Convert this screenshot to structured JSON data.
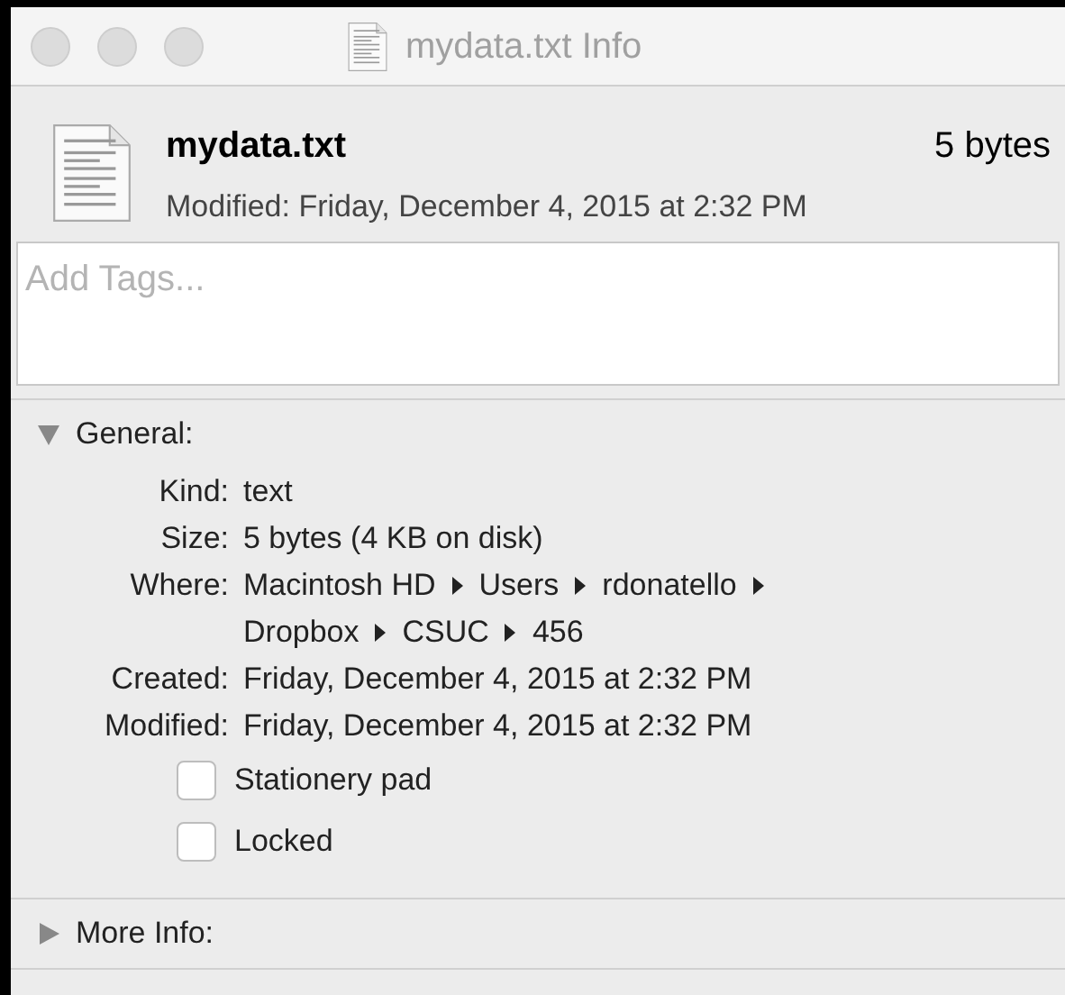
{
  "window": {
    "title": "mydata.txt Info"
  },
  "header": {
    "name": "mydata.txt",
    "size": "5 bytes",
    "modified": "Modified: Friday, December 4, 2015 at 2:32 PM"
  },
  "tags": {
    "placeholder": "Add Tags..."
  },
  "sections": [
    {
      "title": "General:",
      "expanded": true,
      "fields": [
        {
          "kind": "text",
          "label": "Kind:",
          "value": "text"
        },
        {
          "kind": "text",
          "label": "Size:",
          "value": "5 bytes (4 KB on disk)"
        },
        {
          "kind": "path",
          "label": "Where:",
          "segments": [
            "Macintosh HD",
            "Users",
            "rdonatello",
            "Dropbox",
            "CSUC",
            "456"
          ]
        },
        {
          "kind": "text",
          "label": "Created:",
          "value": "Friday, December 4, 2015 at 2:32 PM"
        },
        {
          "kind": "text",
          "label": "Modified:",
          "value": "Friday, December 4, 2015 at 2:32 PM"
        },
        {
          "kind": "checkbox",
          "label": "Stationery pad",
          "checked": false
        },
        {
          "kind": "checkbox",
          "label": "Locked",
          "checked": false
        }
      ]
    },
    {
      "title": "More Info:",
      "expanded": false
    }
  ]
}
